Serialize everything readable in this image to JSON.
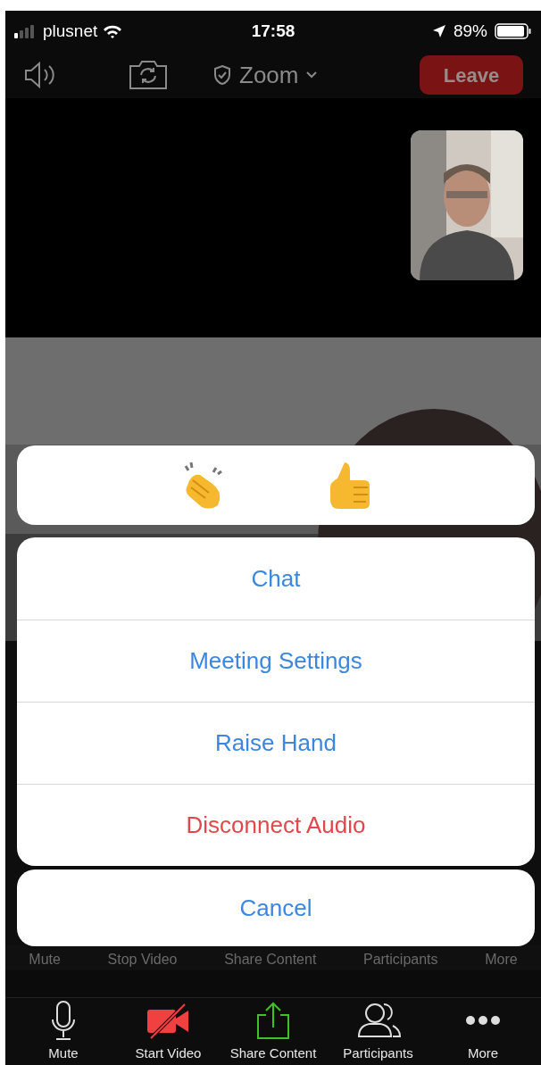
{
  "status_bar": {
    "carrier": "plusnet",
    "time": "17:58",
    "battery": "89%"
  },
  "top_bar": {
    "title": "Zoom",
    "leave": "Leave"
  },
  "reactions": [
    {
      "kind": "clap"
    },
    {
      "kind": "thumbs_up"
    }
  ],
  "actions": [
    {
      "label": "Chat",
      "kind": "default"
    },
    {
      "label": "Meeting Settings",
      "kind": "default"
    },
    {
      "label": "Raise Hand",
      "kind": "default"
    },
    {
      "label": "Disconnect Audio",
      "kind": "destructive"
    }
  ],
  "cancel": "Cancel",
  "dimmed_toolbar": [
    "Mute",
    "Stop Video",
    "Share Content",
    "Participants",
    "More"
  ],
  "toolbar": [
    {
      "label": "Mute",
      "kind": "mic"
    },
    {
      "label": "Start Video",
      "kind": "video_off"
    },
    {
      "label": "Share Content",
      "kind": "share"
    },
    {
      "label": "Participants",
      "kind": "people"
    },
    {
      "label": "More",
      "kind": "more"
    }
  ]
}
